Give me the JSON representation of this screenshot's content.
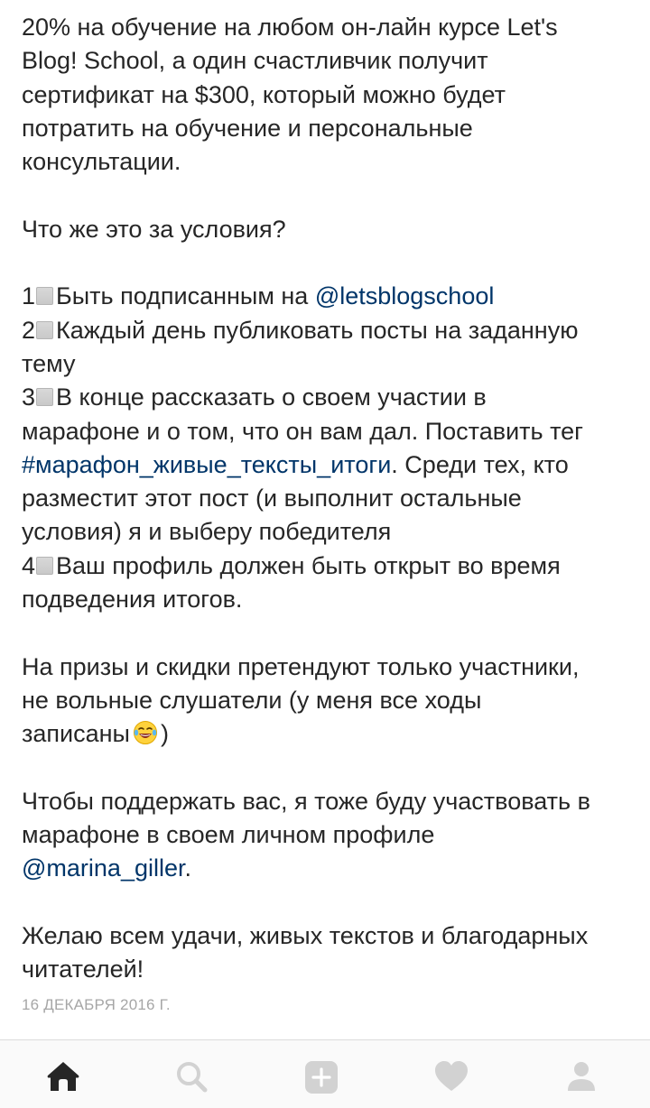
{
  "caption": {
    "p1": [
      "20% на обучение на любом он-лайн курсе Let's",
      "Blog! School, а один счастливчик получит",
      "сертификат на $300, который можно будет",
      "потратить на обучение и персональные",
      "консультации."
    ],
    "question": "Что же это за условия?",
    "item1": {
      "num": "1",
      "text": "Быть подписанным на ",
      "mention": "@letsblogschool"
    },
    "item2": {
      "num": "2",
      "line1": "Каждый день публиковать посты на заданную",
      "line2": "тему"
    },
    "item3": {
      "num": "3",
      "line1": "В конце рассказать о своем участии в",
      "line2": "марафоне и о том, что он вам дал. Поставить тег",
      "hashtag": "#марафон_живые_тексты_итоги",
      "line3_rest": ". Среди тех, кто",
      "line4": "разместит этот пост (и выполнит остальные",
      "line5": "условия) я и выберу победителя"
    },
    "item4": {
      "num": "4",
      "line1": "Ваш профиль должен быть открыт во время",
      "line2": "подведения итогов."
    },
    "p3": {
      "line1": "На призы и скидки претендуют только участники,",
      "line2": "не вольные слушатели (у меня все ходы",
      "line3": "записаны",
      "line3_end": ")",
      "emoji": "laughing-tears-emoji"
    },
    "p4": {
      "line1": "Чтобы поддержать вас, я тоже буду участвовать в",
      "line2": "марафоне в своем личном профиле",
      "mention": "@marina_giller",
      "mention_end": "."
    },
    "p5": {
      "line1": "Желаю всем удачи, живых текстов и благодарных",
      "line2": "читателей!"
    }
  },
  "date": "16 ДЕКАБРЯ 2016 Г.",
  "nav": {
    "items": [
      {
        "icon": "home-icon",
        "active": true
      },
      {
        "icon": "search-icon",
        "active": false
      },
      {
        "icon": "plus-square-icon",
        "active": false
      },
      {
        "icon": "heart-icon",
        "active": false
      },
      {
        "icon": "profile-icon",
        "active": false
      }
    ]
  },
  "colors": {
    "text": "#262626",
    "link": "#003569",
    "date": "#a6a6a6",
    "icon_inactive": "#d2d2d2",
    "icon_active": "#262626",
    "nav_bg": "#fafafa",
    "checkbox": "#c9c9c9"
  }
}
